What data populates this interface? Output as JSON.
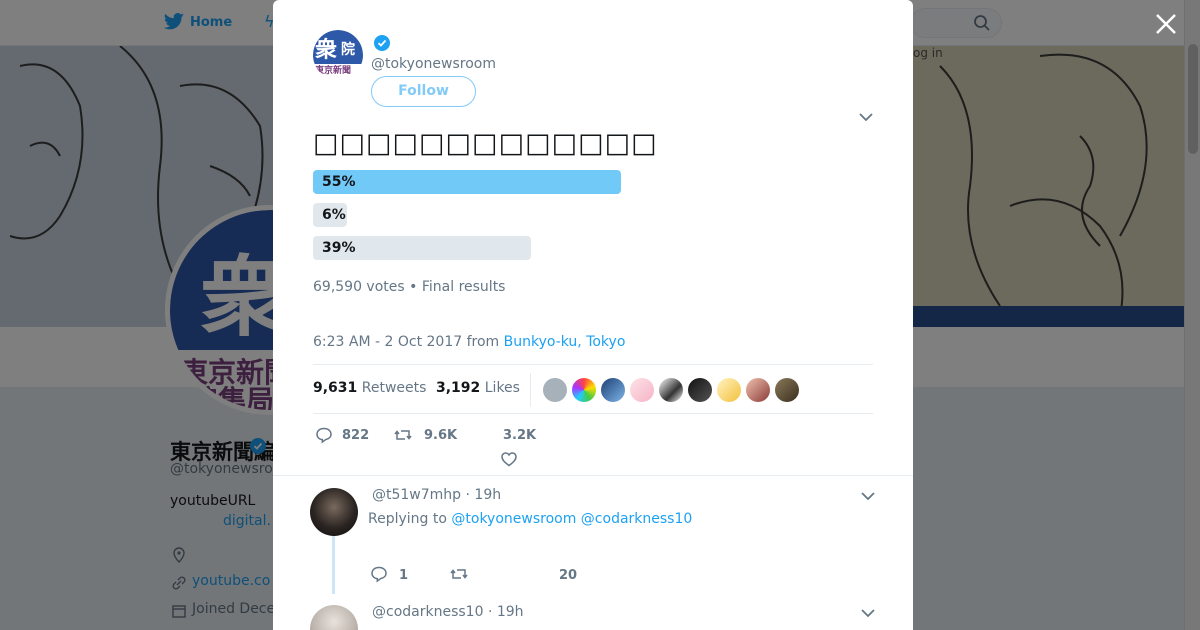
{
  "nav": {
    "home_label": "Home"
  },
  "banner": {
    "login_hint": "og in"
  },
  "profile": {
    "display_name": "東京新聞編集局",
    "handle": "@tokyonewsroom",
    "bio": "youtubeURL",
    "bio_link": "digital.",
    "url": "youtube.co",
    "joined": "Joined Dece"
  },
  "tweet": {
    "author_handle": "@tokyonewsroom",
    "follow_label": "Follow",
    "poll": {
      "question": "□□□□□□□□□□□□□",
      "options": [
        {
          "percent": "55%",
          "value": 55,
          "leading": true
        },
        {
          "percent": "6%",
          "value": 6,
          "leading": false
        },
        {
          "percent": "39%",
          "value": 39,
          "leading": false
        }
      ],
      "votes": "69,590 votes",
      "status": "Final results"
    },
    "timestamp": "6:23 AM - 2 Oct 2017 from",
    "location": "Bunkyo-ku, Tokyo",
    "retweets_count": "9,631",
    "retweets_label": "Retweets",
    "likes_count": "3,192",
    "likes_label": "Likes",
    "actions": {
      "replies": "822",
      "retweets": "9.6K",
      "likes": "3.2K"
    }
  },
  "replies": [
    {
      "handle": "@t51w7mhp",
      "time": "19h",
      "replying_prefix": "Replying to",
      "replying_to": "@tokyonewsroom @codarkness10",
      "reply_count": "1",
      "like_count": "20"
    },
    {
      "handle": "@codarkness10",
      "time": "19h"
    }
  ],
  "colors": {
    "accent": "#1da1f2",
    "poll_leading": "#71c9f8",
    "poll_other": "#e1e8ed"
  }
}
